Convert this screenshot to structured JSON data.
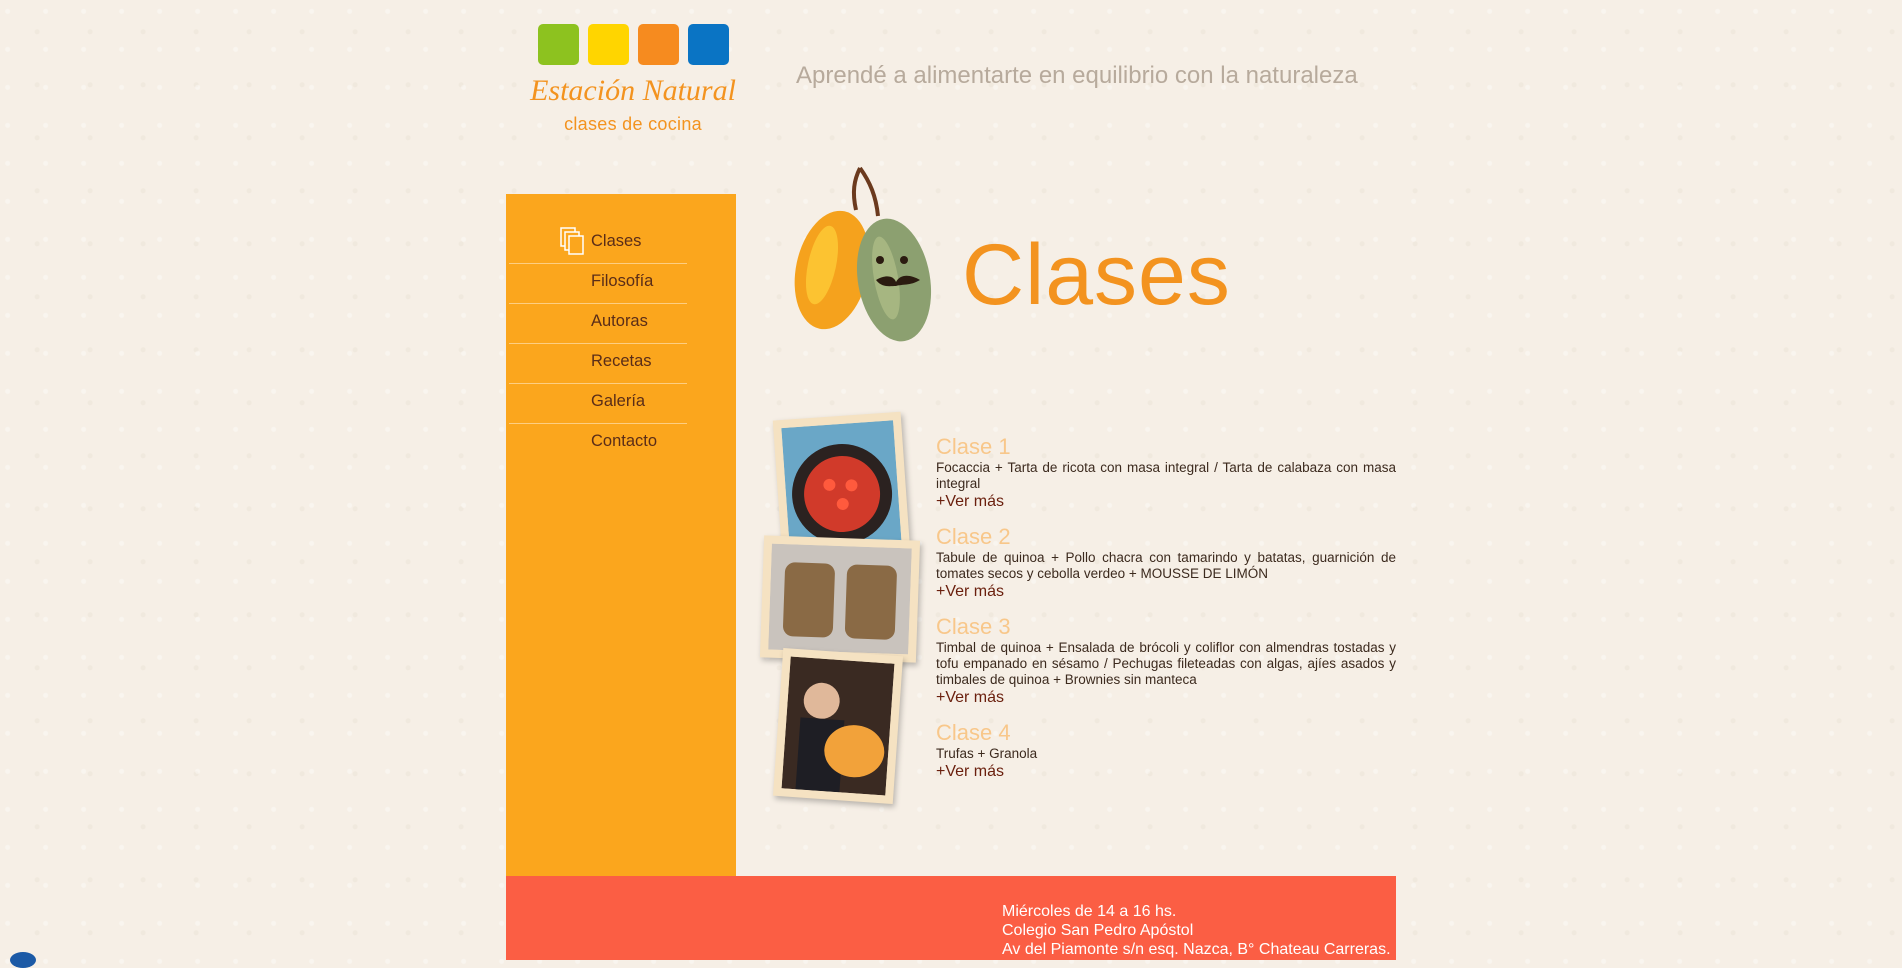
{
  "brand": {
    "name": "Estación Natural",
    "subtitle": "clases de cocina",
    "square_colors": [
      "#8dc21f",
      "#ffd500",
      "#f68b1f",
      "#0a74c4"
    ]
  },
  "tagline": "Aprendé a alimentarte en equilibrio con la naturaleza",
  "sidebar": {
    "color": "#fba61d",
    "items": [
      {
        "label": "Clases",
        "active": true
      },
      {
        "label": "Filosofía"
      },
      {
        "label": "Autoras"
      },
      {
        "label": "Recetas"
      },
      {
        "label": "Galería"
      },
      {
        "label": "Contacto"
      }
    ]
  },
  "page_title": "Clases",
  "classes": [
    {
      "title": "Clase 1",
      "description": "Focaccia + Tarta de ricota con masa integral / Tarta de calabaza con masa integral",
      "more": "+Ver más"
    },
    {
      "title": "Clase 2",
      "description": "Tabule de quinoa + Pollo chacra con tamarindo y batatas, guarnición de tomates secos y cebolla verdeo + MOUSSE DE LIMÓN",
      "more": "+Ver más"
    },
    {
      "title": "Clase 3",
      "description": "Timbal de quinoa + Ensalada de brócoli y coliflor con almendras tostadas y tofu empanado en sésamo / Pechugas fileteadas con algas, ajíes asados y timbales de quinoa + Brownies sin manteca",
      "more": "+Ver más"
    },
    {
      "title": "Clase 4",
      "description": "Trufas + Granola",
      "more": "+Ver más"
    }
  ],
  "footer": {
    "color": "#fb5e44",
    "lines": [
      "Miércoles de 14 a 16 hs.",
      "Colegio San Pedro Apóstol",
      "Av del Piamonte s/n esq. Nazca, B° Chateau Carreras."
    ]
  }
}
